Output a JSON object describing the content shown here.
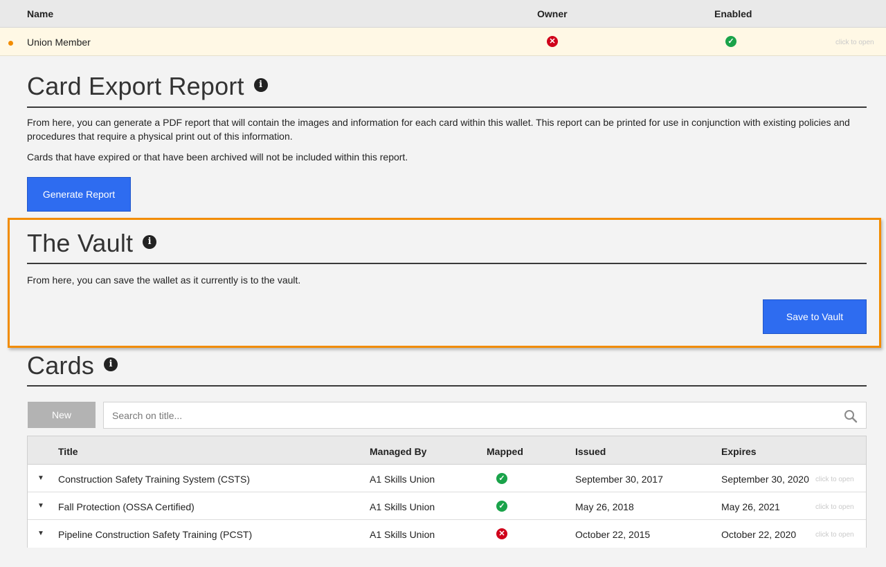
{
  "members_table": {
    "columns": {
      "name": "Name",
      "owner": "Owner",
      "enabled": "Enabled"
    },
    "row": {
      "name": "Union Member",
      "owner": false,
      "enabled": true,
      "hint": "click to open"
    }
  },
  "card_export": {
    "title": "Card Export Report",
    "paragraph1": "From here, you can generate a PDF report that will contain the images and information for each card within this wallet. This report can be printed for use in conjunction with existing policies and procedures that require a physical print out of this information.",
    "paragraph2": "Cards that have expired or that have been archived will not be included within this report.",
    "button": "Generate Report"
  },
  "vault": {
    "title": "The Vault",
    "paragraph": "From here, you can save the wallet as it currently is to the vault.",
    "button": "Save to Vault"
  },
  "cards": {
    "title": "Cards",
    "new_button": "New",
    "search_placeholder": "Search on title...",
    "columns": {
      "title": "Title",
      "managed_by": "Managed By",
      "mapped": "Mapped",
      "issued": "Issued",
      "expires": "Expires"
    },
    "rows": [
      {
        "title": "Construction Safety Training System (CSTS)",
        "managed_by": "A1 Skills Union",
        "mapped": true,
        "issued": "September 30, 2017",
        "expires": "September 30, 2020",
        "hint": "click to open"
      },
      {
        "title": "Fall Protection (OSSA Certified)",
        "managed_by": "A1 Skills Union",
        "mapped": true,
        "issued": "May 26, 2018",
        "expires": "May 26, 2021",
        "hint": "click to open"
      },
      {
        "title": "Pipeline Construction Safety Training (PCST)",
        "managed_by": "A1 Skills Union",
        "mapped": false,
        "issued": "October 22, 2015",
        "expires": "October 22, 2020",
        "hint": "click to open"
      }
    ]
  },
  "colors": {
    "accent": "#2e6cf0",
    "highlight_border": "#f28c00",
    "ok": "#1aa34a",
    "error": "#d0021b"
  }
}
